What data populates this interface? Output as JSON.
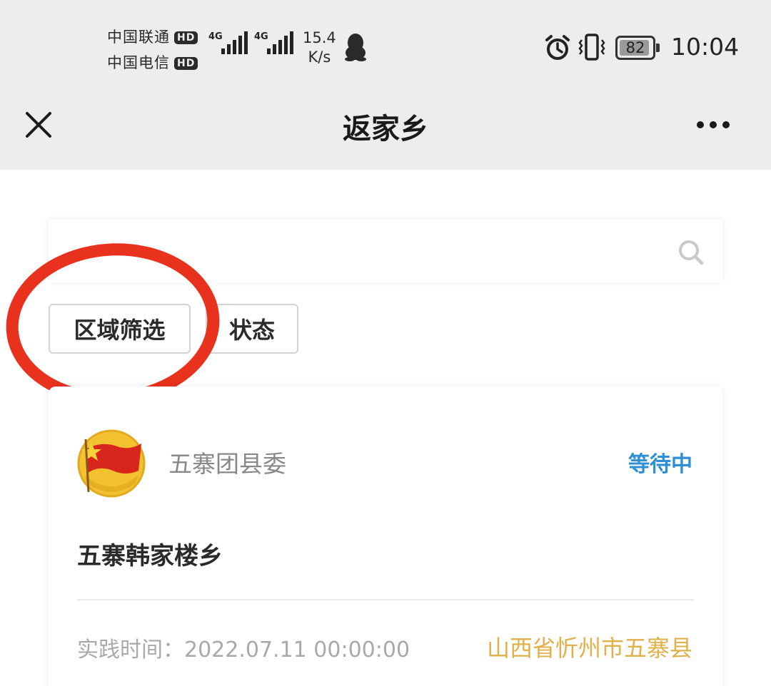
{
  "status_bar": {
    "carrier_1": "中国联通",
    "carrier_2": "中国电信",
    "hd_badge": "HD",
    "network_tag": "4G",
    "net_speed_value": "15.4",
    "net_speed_unit": "K/s",
    "battery_level": "82",
    "time": "10:04"
  },
  "nav": {
    "title": "返家乡"
  },
  "search": {
    "placeholder": ""
  },
  "filters": {
    "region_label": "区域筛选",
    "status_label": "状态"
  },
  "card": {
    "org_name": "五寨团县委",
    "status": "等待中",
    "title": "五寨韩家楼乡",
    "practice_time": "实践时间：2022.07.11 00:00:00",
    "location": "山西省忻州市五寨县"
  },
  "colors": {
    "status_blue": "#2f8fd4",
    "location_gold": "#e0b14b",
    "highlight_red": "#e8321e",
    "header_gray": "#ededed"
  }
}
